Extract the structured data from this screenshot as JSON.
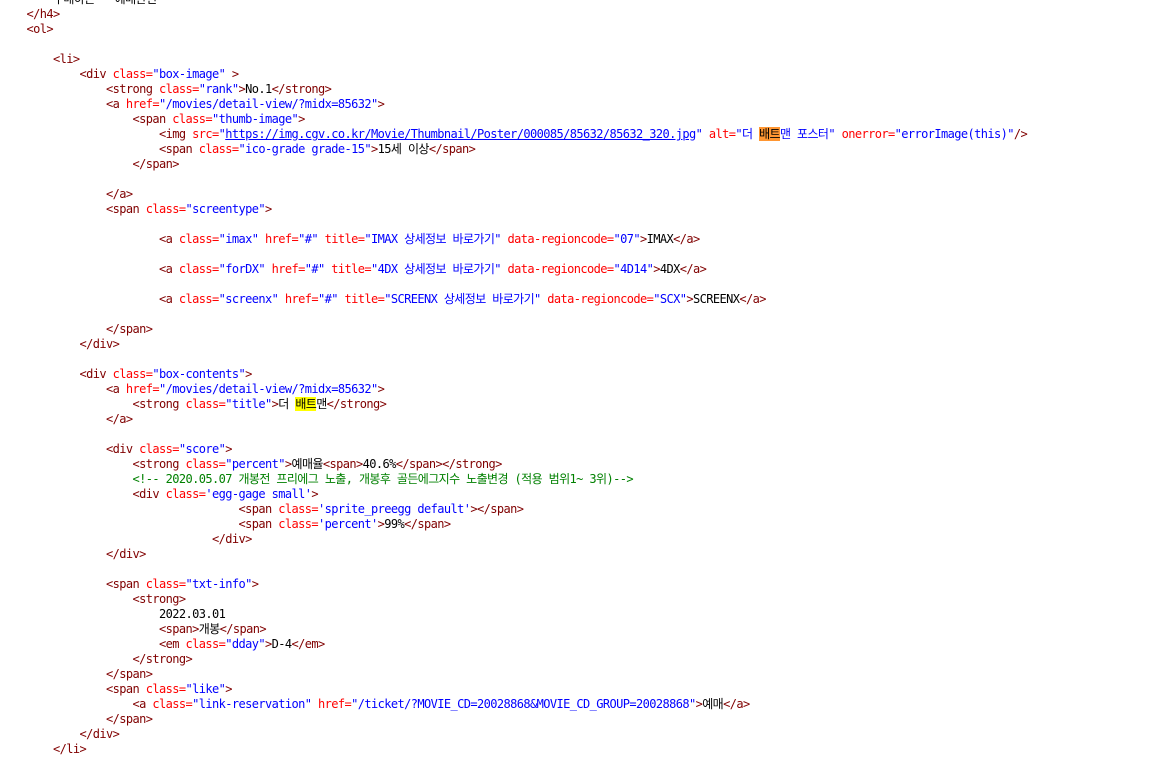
{
  "colors": {
    "background": "#ffffff",
    "tag": "#800000",
    "attribute_name": "#ff0000",
    "attribute_value": "#0000ff",
    "text": "#000000",
    "comment": "#008000",
    "highlight_current_match": "#ff9632",
    "highlight_match": "#ffff00"
  },
  "lines": [
    [
      {
        "t": "txt",
        "s": "        구매하는 - 예매관련"
      }
    ],
    [
      {
        "t": "tag",
        "s": "    </h4>"
      }
    ],
    [
      {
        "t": "tag",
        "s": "    <ol>"
      }
    ],
    [],
    [
      {
        "t": "tag",
        "s": "        <li>"
      }
    ],
    [
      {
        "t": "tag",
        "s": "            <div "
      },
      {
        "t": "attr",
        "s": "class="
      },
      {
        "t": "val",
        "s": "\"box-image\""
      },
      {
        "t": "tag",
        "s": " >"
      }
    ],
    [
      {
        "t": "tag",
        "s": "                <strong "
      },
      {
        "t": "attr",
        "s": "class="
      },
      {
        "t": "val",
        "s": "\"rank\""
      },
      {
        "t": "tag",
        "s": ">"
      },
      {
        "t": "txt",
        "s": "No.1"
      },
      {
        "t": "tag",
        "s": "</strong>"
      }
    ],
    [
      {
        "t": "tag",
        "s": "                <a "
      },
      {
        "t": "attr",
        "s": "href="
      },
      {
        "t": "val",
        "s": "\"/movies/detail-view/?midx=85632\""
      },
      {
        "t": "tag",
        "s": ">"
      }
    ],
    [
      {
        "t": "tag",
        "s": "                    <span "
      },
      {
        "t": "attr",
        "s": "class="
      },
      {
        "t": "val",
        "s": "\"thumb-image\""
      },
      {
        "t": "tag",
        "s": ">"
      }
    ],
    [
      {
        "t": "tag",
        "s": "                        <img "
      },
      {
        "t": "attr",
        "s": "src="
      },
      {
        "t": "val",
        "s": "\""
      },
      {
        "t": "link",
        "s": "https://img.cgv.co.kr/Movie/Thumbnail/Poster/000085/85632/85632_320.jpg"
      },
      {
        "t": "val",
        "s": "\""
      },
      {
        "t": "attr",
        "s": " alt="
      },
      {
        "t": "val",
        "s": "\"더 "
      },
      {
        "t": "hl-o",
        "s": "배트"
      },
      {
        "t": "val",
        "s": "맨 포스터\""
      },
      {
        "t": "attr",
        "s": " onerror="
      },
      {
        "t": "val",
        "s": "\"errorImage(this)\""
      },
      {
        "t": "tag",
        "s": "/>"
      }
    ],
    [
      {
        "t": "tag",
        "s": "                        <span "
      },
      {
        "t": "attr",
        "s": "class="
      },
      {
        "t": "val",
        "s": "\"ico-grade grade-15\""
      },
      {
        "t": "tag",
        "s": ">"
      },
      {
        "t": "txt",
        "s": "15세 이상"
      },
      {
        "t": "tag",
        "s": "</span>"
      }
    ],
    [
      {
        "t": "tag",
        "s": "                    </span>"
      }
    ],
    [],
    [
      {
        "t": "tag",
        "s": "                </a>"
      }
    ],
    [
      {
        "t": "tag",
        "s": "                <span "
      },
      {
        "t": "attr",
        "s": "class="
      },
      {
        "t": "val",
        "s": "\"screentype\""
      },
      {
        "t": "tag",
        "s": ">"
      }
    ],
    [],
    [
      {
        "t": "tag",
        "s": "                        <a "
      },
      {
        "t": "attr",
        "s": "class="
      },
      {
        "t": "val",
        "s": "\"imax\""
      },
      {
        "t": "attr",
        "s": " href="
      },
      {
        "t": "val",
        "s": "\"#\""
      },
      {
        "t": "attr",
        "s": " title="
      },
      {
        "t": "val",
        "s": "\"IMAX 상세정보 바로가기\""
      },
      {
        "t": "attr",
        "s": " data-regioncode="
      },
      {
        "t": "val",
        "s": "\"07\""
      },
      {
        "t": "tag",
        "s": ">"
      },
      {
        "t": "txt",
        "s": "IMAX"
      },
      {
        "t": "tag",
        "s": "</a>"
      }
    ],
    [],
    [
      {
        "t": "tag",
        "s": "                        <a "
      },
      {
        "t": "attr",
        "s": "class="
      },
      {
        "t": "val",
        "s": "\"forDX\""
      },
      {
        "t": "attr",
        "s": " href="
      },
      {
        "t": "val",
        "s": "\"#\""
      },
      {
        "t": "attr",
        "s": " title="
      },
      {
        "t": "val",
        "s": "\"4DX 상세정보 바로가기\""
      },
      {
        "t": "attr",
        "s": " data-regioncode="
      },
      {
        "t": "val",
        "s": "\"4D14\""
      },
      {
        "t": "tag",
        "s": ">"
      },
      {
        "t": "txt",
        "s": "4DX"
      },
      {
        "t": "tag",
        "s": "</a>"
      }
    ],
    [],
    [
      {
        "t": "tag",
        "s": "                        <a "
      },
      {
        "t": "attr",
        "s": "class="
      },
      {
        "t": "val",
        "s": "\"screenx\""
      },
      {
        "t": "attr",
        "s": " href="
      },
      {
        "t": "val",
        "s": "\"#\""
      },
      {
        "t": "attr",
        "s": " title="
      },
      {
        "t": "val",
        "s": "\"SCREENX 상세정보 바로가기\""
      },
      {
        "t": "attr",
        "s": " data-regioncode="
      },
      {
        "t": "val",
        "s": "\"SCX\""
      },
      {
        "t": "tag",
        "s": ">"
      },
      {
        "t": "txt",
        "s": "SCREENX"
      },
      {
        "t": "tag",
        "s": "</a>"
      }
    ],
    [],
    [
      {
        "t": "tag",
        "s": "                </span>"
      }
    ],
    [
      {
        "t": "tag",
        "s": "            </div>"
      }
    ],
    [],
    [
      {
        "t": "tag",
        "s": "            <div "
      },
      {
        "t": "attr",
        "s": "class="
      },
      {
        "t": "val",
        "s": "\"box-contents\""
      },
      {
        "t": "tag",
        "s": ">"
      }
    ],
    [
      {
        "t": "tag",
        "s": "                <a "
      },
      {
        "t": "attr",
        "s": "href="
      },
      {
        "t": "val",
        "s": "\"/movies/detail-view/?midx=85632\""
      },
      {
        "t": "tag",
        "s": ">"
      }
    ],
    [
      {
        "t": "tag",
        "s": "                    <strong "
      },
      {
        "t": "attr",
        "s": "class="
      },
      {
        "t": "val",
        "s": "\"title\""
      },
      {
        "t": "tag",
        "s": ">"
      },
      {
        "t": "txt",
        "s": "더 "
      },
      {
        "t": "hl-y",
        "s": "배트"
      },
      {
        "t": "txt",
        "s": "맨"
      },
      {
        "t": "tag",
        "s": "</strong>"
      }
    ],
    [
      {
        "t": "tag",
        "s": "                </a>"
      }
    ],
    [],
    [
      {
        "t": "tag",
        "s": "                <div "
      },
      {
        "t": "attr",
        "s": "class="
      },
      {
        "t": "val",
        "s": "\"score\""
      },
      {
        "t": "tag",
        "s": ">"
      }
    ],
    [
      {
        "t": "tag",
        "s": "                    <strong "
      },
      {
        "t": "attr",
        "s": "class="
      },
      {
        "t": "val",
        "s": "\"percent\""
      },
      {
        "t": "tag",
        "s": ">"
      },
      {
        "t": "txt",
        "s": "예매율"
      },
      {
        "t": "tag",
        "s": "<span>"
      },
      {
        "t": "txt",
        "s": "40.6%"
      },
      {
        "t": "tag",
        "s": "</span></strong>"
      }
    ],
    [
      {
        "t": "cmt",
        "s": "                    <!-- 2020.05.07 개봉전 프리에그 노출, 개봉후 골든에그지수 노출변경 (적용 범위1~ 3위)-->"
      }
    ],
    [
      {
        "t": "tag",
        "s": "                    <div "
      },
      {
        "t": "attr",
        "s": "class="
      },
      {
        "t": "val",
        "s": "'egg-gage small'"
      },
      {
        "t": "tag",
        "s": ">"
      }
    ],
    [
      {
        "t": "tag",
        "s": "                                    <span "
      },
      {
        "t": "attr",
        "s": "class="
      },
      {
        "t": "val",
        "s": "'sprite_preegg default'"
      },
      {
        "t": "tag",
        "s": "></span>"
      }
    ],
    [
      {
        "t": "tag",
        "s": "                                    <span "
      },
      {
        "t": "attr",
        "s": "class="
      },
      {
        "t": "val",
        "s": "'percent'"
      },
      {
        "t": "tag",
        "s": ">"
      },
      {
        "t": "txt",
        "s": "99%"
      },
      {
        "t": "tag",
        "s": "</span>"
      }
    ],
    [
      {
        "t": "tag",
        "s": "                                </div>"
      }
    ],
    [
      {
        "t": "tag",
        "s": "                </div>"
      }
    ],
    [],
    [
      {
        "t": "tag",
        "s": "                <span "
      },
      {
        "t": "attr",
        "s": "class="
      },
      {
        "t": "val",
        "s": "\"txt-info\""
      },
      {
        "t": "tag",
        "s": ">"
      }
    ],
    [
      {
        "t": "tag",
        "s": "                    <strong>"
      }
    ],
    [
      {
        "t": "txt",
        "s": "                        2022.03.01"
      }
    ],
    [
      {
        "t": "tag",
        "s": "                        <span>"
      },
      {
        "t": "txt",
        "s": "개봉"
      },
      {
        "t": "tag",
        "s": "</span>"
      }
    ],
    [
      {
        "t": "tag",
        "s": "                        <em "
      },
      {
        "t": "attr",
        "s": "class="
      },
      {
        "t": "val",
        "s": "\"dday\""
      },
      {
        "t": "tag",
        "s": ">"
      },
      {
        "t": "txt",
        "s": "D-4"
      },
      {
        "t": "tag",
        "s": "</em>"
      }
    ],
    [
      {
        "t": "tag",
        "s": "                    </strong>"
      }
    ],
    [
      {
        "t": "tag",
        "s": "                </span>"
      }
    ],
    [
      {
        "t": "tag",
        "s": "                <span "
      },
      {
        "t": "attr",
        "s": "class="
      },
      {
        "t": "val",
        "s": "\"like\""
      },
      {
        "t": "tag",
        "s": ">"
      }
    ],
    [
      {
        "t": "tag",
        "s": "                    <a "
      },
      {
        "t": "attr",
        "s": "class="
      },
      {
        "t": "val",
        "s": "\"link-reservation\""
      },
      {
        "t": "attr",
        "s": " href="
      },
      {
        "t": "val",
        "s": "\"/ticket/?MOVIE_CD=20028868&MOVIE_CD_GROUP=20028868\""
      },
      {
        "t": "tag",
        "s": ">"
      },
      {
        "t": "txt",
        "s": "예매"
      },
      {
        "t": "tag",
        "s": "</a>"
      }
    ],
    [
      {
        "t": "tag",
        "s": "                </span>"
      }
    ],
    [
      {
        "t": "tag",
        "s": "            </div>"
      }
    ],
    [
      {
        "t": "tag",
        "s": "        </li>"
      }
    ]
  ]
}
